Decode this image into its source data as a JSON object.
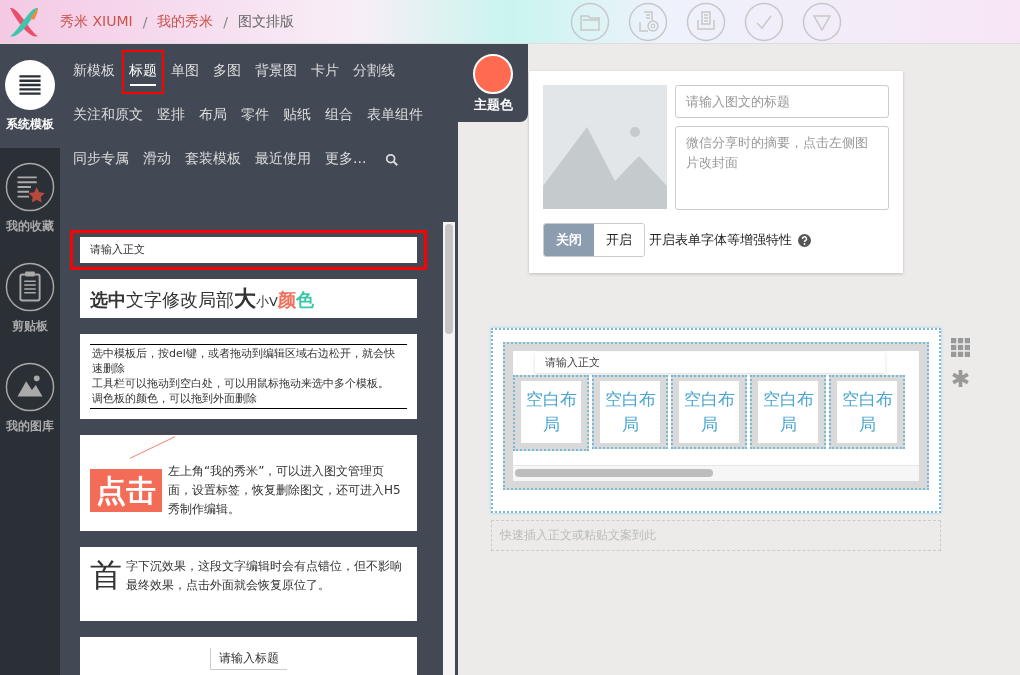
{
  "header": {
    "breadcrumbs": [
      {
        "label": "秀米 XIUMI",
        "kind": "link"
      },
      {
        "label": "我的秀米",
        "kind": "link"
      },
      {
        "label": "图文排版",
        "kind": "current"
      }
    ],
    "separator": "/",
    "toolbar": [
      {
        "kind": "folder"
      },
      {
        "kind": "disc"
      },
      {
        "kind": "tray"
      },
      {
        "kind": "check"
      },
      {
        "kind": "triangle"
      }
    ]
  },
  "rail": [
    {
      "label": "系统模板",
      "kind": "lines",
      "selected": true
    },
    {
      "label": "我的收藏",
      "kind": "star",
      "selected": false
    },
    {
      "label": "剪贴板",
      "kind": "clipboard",
      "selected": false
    },
    {
      "label": "我的图库",
      "kind": "picture",
      "selected": false
    }
  ],
  "categories": [
    {
      "label": "新模板",
      "selected": false
    },
    {
      "label": "标题",
      "selected": true
    },
    {
      "label": "单图",
      "selected": false
    },
    {
      "label": "多图",
      "selected": false
    },
    {
      "label": "背景图",
      "selected": false
    },
    {
      "label": "卡片",
      "selected": false
    },
    {
      "label": "分割线",
      "selected": false
    },
    {
      "label": "关注和原文",
      "selected": false
    },
    {
      "label": "竖排",
      "selected": false
    },
    {
      "label": "布局",
      "selected": false
    },
    {
      "label": "零件",
      "selected": false
    },
    {
      "label": "贴纸",
      "selected": false
    },
    {
      "label": "组合",
      "selected": false
    },
    {
      "label": "表单组件",
      "selected": false
    },
    {
      "label": "同步专属",
      "selected": false
    },
    {
      "label": "滑动",
      "selected": false
    },
    {
      "label": "套装模板",
      "selected": false
    },
    {
      "label": "最近使用",
      "selected": false
    },
    {
      "label": "更多...",
      "selected": false
    }
  ],
  "theme": {
    "label": "主题色"
  },
  "templates": [
    {
      "kind": "plain",
      "text": "请输入正文",
      "selected": true
    },
    {
      "kind": "mixed",
      "selected": false,
      "parts": [
        "选中",
        "文字修改局部",
        "大",
        "小V",
        "颜",
        "色"
      ]
    },
    {
      "kind": "ruled",
      "selected": false,
      "lines": [
        "选中模板后，按del键，或者拖动到编辑区域右边松开，就会快速删除",
        "工具栏可以拖动到空白处，可以用鼠标拖动来选中多个模板。",
        "调色板的颜色，可以拖到外面删除"
      ]
    },
    {
      "kind": "badge",
      "selected": false,
      "badge": "点击",
      "text": "左上角“我的秀米”，可以进入图文管理页面，设置标签，恢复删除图文，还可进入H5秀制作编辑。"
    },
    {
      "kind": "dropcap",
      "selected": false,
      "badge": "首",
      "text": "字下沉效果，这段文字编辑时会有点错位，但不影响最终效果，点击外面就会恢复原位了。"
    },
    {
      "kind": "title",
      "selected": false,
      "text": "请输入标题"
    }
  ],
  "cover": {
    "title_placeholder": "请输入图文的标题",
    "summary_placeholder": "微信分享时的摘要，点击左侧图片改封面",
    "toggle": [
      {
        "label": "关闭",
        "selected": true
      },
      {
        "label": "开启",
        "selected": false
      }
    ],
    "toggle_label": "开启表单字体等增强特性"
  },
  "layout_block": {
    "cells": [
      "空白布局",
      "空白布局",
      "空白布局",
      "空白布局",
      "空白布局"
    ],
    "floating_text": "请输入正文"
  },
  "quick_insert": {
    "placeholder": "快速插入正文或粘贴文案到此"
  }
}
